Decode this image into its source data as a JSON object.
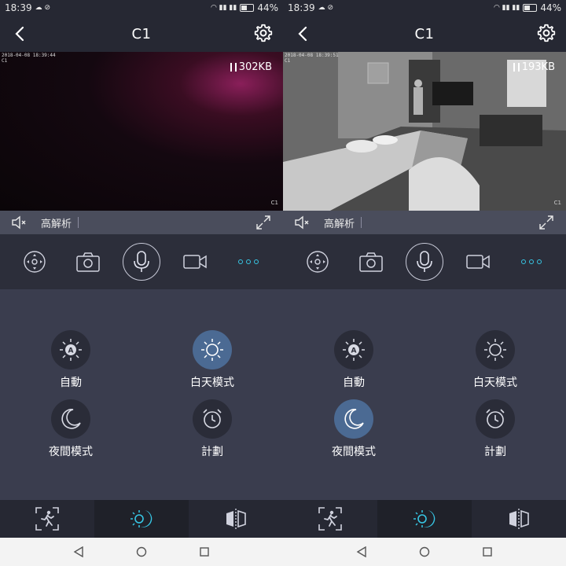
{
  "colors": {
    "accent_cyan": "#37c6e4",
    "active_mode_bg": "#4b6a93",
    "panel_bg": "#3a3d4e",
    "header_bg": "#262833"
  },
  "panels": [
    {
      "status": {
        "time": "18:39",
        "battery": "44%",
        "battery_level": 0.44
      },
      "header": {
        "title": "C1",
        "back_icon": "chevron-left-icon",
        "settings_icon": "gear-icon"
      },
      "video": {
        "timestamp": "2018-04-08 18:39:44\nC1",
        "bitrate": "302KB",
        "watermark": "C1"
      },
      "video_bar": {
        "resolution": "高解析"
      },
      "modes": [
        {
          "label": "自動",
          "icon": "sun-auto-icon",
          "active": false
        },
        {
          "label": "白天模式",
          "icon": "sun-icon",
          "active": true
        },
        {
          "label": "夜間模式",
          "icon": "moon-icon",
          "active": false
        },
        {
          "label": "計劃",
          "icon": "alarm-clock-icon",
          "active": false
        }
      ]
    },
    {
      "status": {
        "time": "18:39",
        "battery": "44%",
        "battery_level": 0.44
      },
      "header": {
        "title": "C1",
        "back_icon": "chevron-left-icon",
        "settings_icon": "gear-icon"
      },
      "video": {
        "timestamp": "2018-04-08 18:39:51\nC1",
        "bitrate": "193KB",
        "watermark": "C1"
      },
      "video_bar": {
        "resolution": "高解析"
      },
      "modes": [
        {
          "label": "自動",
          "icon": "sun-auto-icon",
          "active": false
        },
        {
          "label": "白天模式",
          "icon": "sun-icon",
          "active": false
        },
        {
          "label": "夜間模式",
          "icon": "moon-icon",
          "active": true
        },
        {
          "label": "計劃",
          "icon": "alarm-clock-icon",
          "active": false
        }
      ]
    }
  ]
}
